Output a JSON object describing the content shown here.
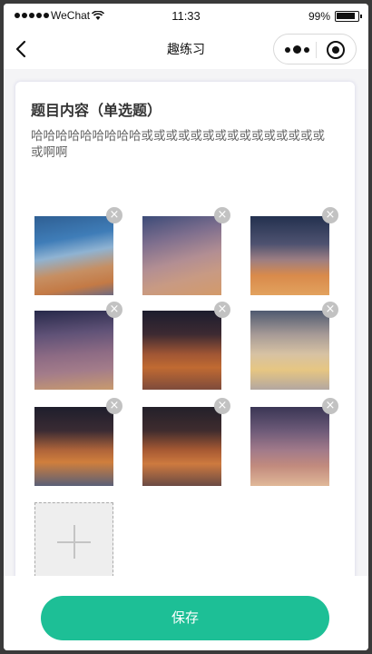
{
  "status_bar": {
    "carrier": "WeChat",
    "time": "11:33",
    "battery": "99%"
  },
  "nav": {
    "title": "趣练习"
  },
  "question": {
    "type_label": "题目内容（单选题）",
    "text": "哈哈哈哈哈哈哈哈哈或或或或或或或或或或或或或或或或啊啊"
  },
  "images": [
    {
      "icon": "photo-sky",
      "remove_label": "×"
    },
    {
      "icon": "photo-sky",
      "remove_label": "×"
    },
    {
      "icon": "photo-sky",
      "remove_label": "×"
    },
    {
      "icon": "photo-sky",
      "remove_label": "×"
    },
    {
      "icon": "photo-sky",
      "remove_label": "×"
    },
    {
      "icon": "photo-sky",
      "remove_label": "×"
    },
    {
      "icon": "photo-sky",
      "remove_label": "×"
    },
    {
      "icon": "photo-sky",
      "remove_label": "×"
    },
    {
      "icon": "photo-sky",
      "remove_label": "×"
    }
  ],
  "actions": {
    "save_label": "保存"
  },
  "colors": {
    "accent": "#1dbf96",
    "remove_badge": "#c2c2c2"
  }
}
